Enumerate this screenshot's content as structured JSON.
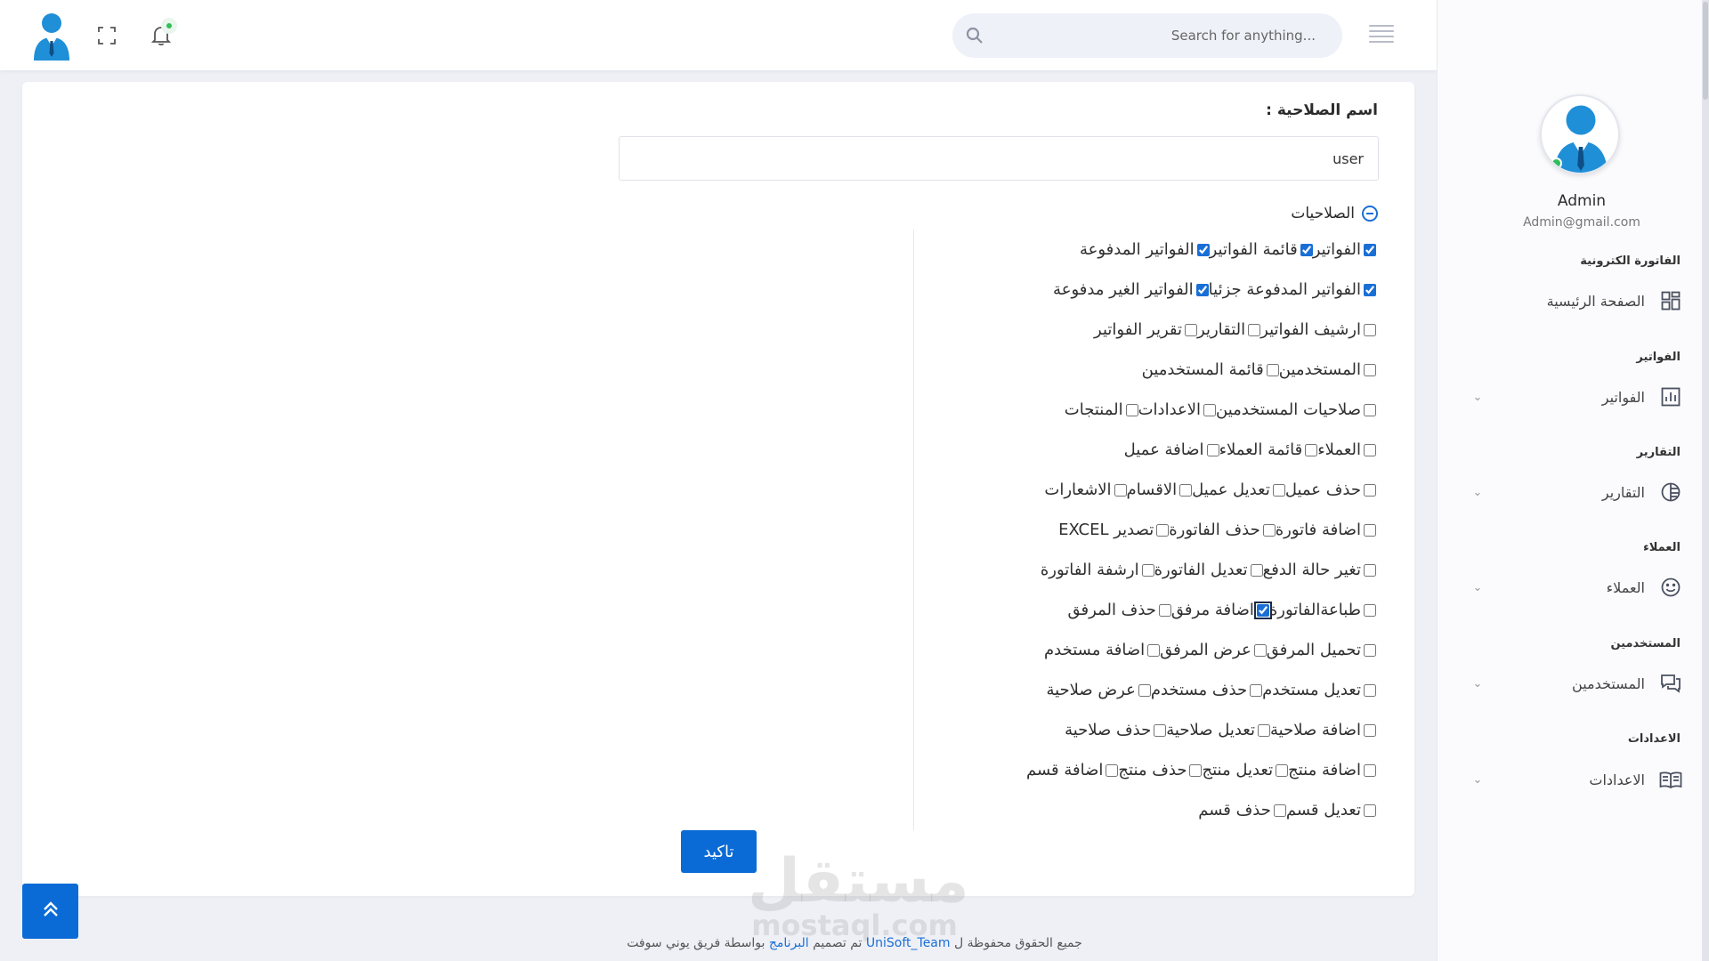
{
  "topbar": {
    "search_placeholder": "Search for anything..."
  },
  "sidebar": {
    "profile_name": "Admin",
    "profile_email": "Admin@gmail.com",
    "sections": [
      {
        "title": "الفاتورة الكترونية",
        "item": "الصفحة الرئيسية",
        "icon": "dashboard-icon",
        "has_chevron": false
      },
      {
        "title": "الفواتير",
        "item": "الفواتير",
        "icon": "chart-icon",
        "has_chevron": true
      },
      {
        "title": "التقارير",
        "item": "التقارير",
        "icon": "pie-icon",
        "has_chevron": true
      },
      {
        "title": "العملاء",
        "item": "العملاء",
        "icon": "smiley-icon",
        "has_chevron": true
      },
      {
        "title": "المستخدمين",
        "item": "المستخدمين",
        "icon": "chat-icon",
        "has_chevron": true
      },
      {
        "title": "الاعدادات",
        "item": "الاعدادات",
        "icon": "book-icon",
        "has_chevron": true
      }
    ]
  },
  "form": {
    "role_label": "اسم الصلاحية :",
    "role_value": "user",
    "permissions_heading": "الصلاحيات",
    "confirm_label": "تاكيد",
    "permission_rows": [
      [
        {
          "label": "الفواتير",
          "checked": true
        },
        {
          "label": "قائمة الفواتير",
          "checked": true
        },
        {
          "label": "الفواتير المدفوعة",
          "checked": true
        }
      ],
      [
        {
          "label": "الفواتير المدفوعة جزئيا",
          "checked": true
        },
        {
          "label": "الفواتير الغير مدفوعة",
          "checked": true
        }
      ],
      [
        {
          "label": "ارشيف الفواتير",
          "checked": false
        },
        {
          "label": "التقارير",
          "checked": false
        },
        {
          "label": "تقرير الفواتير",
          "checked": false
        }
      ],
      [
        {
          "label": "المستخدمين",
          "checked": false
        },
        {
          "label": "قائمة المستخدمين",
          "checked": false
        }
      ],
      [
        {
          "label": "صلاحيات المستخدمين",
          "checked": false
        },
        {
          "label": "الاعدادات",
          "checked": false
        },
        {
          "label": "المنتجات",
          "checked": false
        }
      ],
      [
        {
          "label": "العملاء",
          "checked": false
        },
        {
          "label": "قائمة العملاء",
          "checked": false
        },
        {
          "label": "اضافة عميل",
          "checked": false
        }
      ],
      [
        {
          "label": "حذف عميل",
          "checked": false
        },
        {
          "label": "تعديل عميل",
          "checked": false
        },
        {
          "label": "الاقسام",
          "checked": false
        },
        {
          "label": "الاشعارات",
          "checked": false
        }
      ],
      [
        {
          "label": "اضافة فاتورة",
          "checked": false
        },
        {
          "label": "حذف الفاتورة",
          "checked": false
        },
        {
          "label": "تصدير EXCEL",
          "checked": false
        }
      ],
      [
        {
          "label": "تغير حالة الدفع",
          "checked": false
        },
        {
          "label": "تعديل الفاتورة",
          "checked": false
        },
        {
          "label": "ارشفة الفاتورة",
          "checked": false
        }
      ],
      [
        {
          "label": "طباعةالفاتورة",
          "checked": false
        },
        {
          "label": "اضافة مرفق",
          "checked": true,
          "focused": true
        },
        {
          "label": "حذف المرفق",
          "checked": false
        }
      ],
      [
        {
          "label": "تحميل المرفق",
          "checked": false
        },
        {
          "label": "عرض المرفق",
          "checked": false
        },
        {
          "label": "اضافة مستخدم",
          "checked": false
        }
      ],
      [
        {
          "label": "تعديل مستخدم",
          "checked": false
        },
        {
          "label": "حذف مستخدم",
          "checked": false
        },
        {
          "label": "عرض صلاحية",
          "checked": false
        }
      ],
      [
        {
          "label": "اضافة صلاحية",
          "checked": false
        },
        {
          "label": "تعديل صلاحية",
          "checked": false
        },
        {
          "label": "حذف صلاحية",
          "checked": false
        }
      ],
      [
        {
          "label": "اضافة منتج",
          "checked": false
        },
        {
          "label": "تعديل منتج",
          "checked": false
        },
        {
          "label": "حذف منتج",
          "checked": false
        },
        {
          "label": "اضافة قسم",
          "checked": false
        }
      ],
      [
        {
          "label": "تعديل قسم",
          "checked": false
        },
        {
          "label": "حذف قسم",
          "checked": false
        }
      ]
    ]
  },
  "watermark": {
    "arabic": "مستقل",
    "latin": "mostaql.com"
  },
  "footer": {
    "prefix": "جميع الحقوق محفوظة ل",
    "team": "UniSoft_Team",
    "middle": "تم تصميم",
    "program": "البرنامج",
    "suffix": "بواسطة فريق يوني سوفت"
  },
  "colors": {
    "accent": "#0b6bd6",
    "online": "#2fbf57"
  }
}
